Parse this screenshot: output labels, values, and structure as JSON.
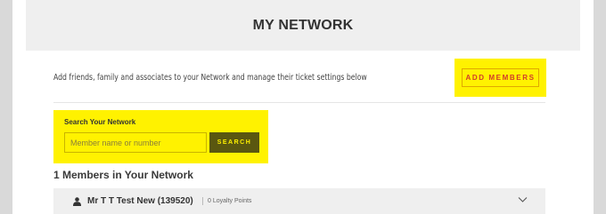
{
  "header": {
    "title": "MY NETWORK"
  },
  "intro": {
    "text": "Add friends, family and associates to your Network and manage their ticket settings below"
  },
  "add_members": {
    "label": "ADD MEMBERS"
  },
  "search": {
    "label": "Search Your Network",
    "placeholder": "Member name or number",
    "value": "",
    "button_label": "SEARCH"
  },
  "members": {
    "count_text": "1 Members in Your Network",
    "items": [
      {
        "name": "Mr T T Test New (139520)",
        "points": "0 Loyalty Points",
        "icon": "person-icon",
        "expand_icon": "chevron-down-icon"
      }
    ]
  },
  "colors": {
    "highlight": "#fff200",
    "add_button_text": "#d13c2a",
    "search_button_bg": "#5a5710",
    "header_band": "#efefef"
  }
}
